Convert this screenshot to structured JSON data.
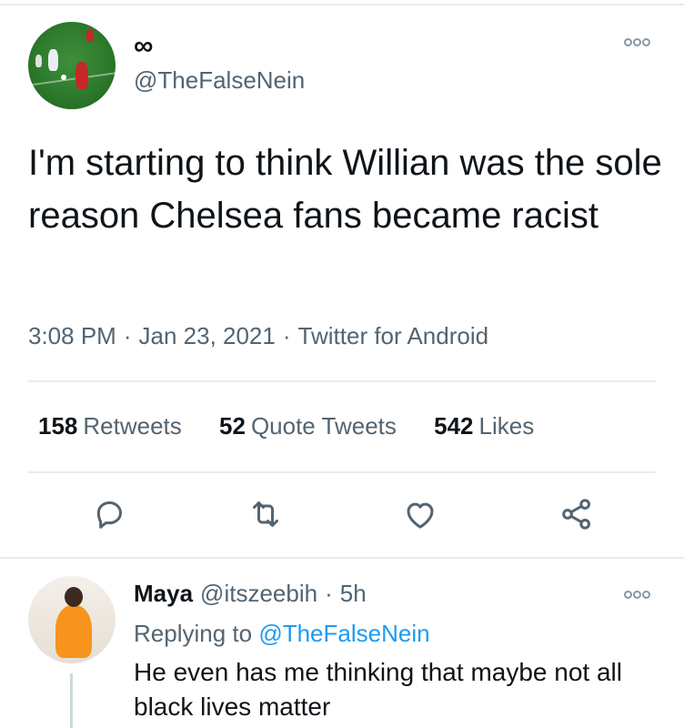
{
  "tweet": {
    "display_name": "∞",
    "handle": "@TheFalseNein",
    "text": "I'm starting to think Willian was the sole reason Chelsea fans became racist",
    "time": "3:08 PM",
    "date": "Jan 23, 2021",
    "client": "Twitter for Android",
    "separator": "·"
  },
  "stats": [
    {
      "count": "158",
      "label": "Retweets"
    },
    {
      "count": "52",
      "label": "Quote Tweets"
    },
    {
      "count": "542",
      "label": "Likes"
    }
  ],
  "actions": [
    "reply-icon",
    "retweet-icon",
    "like-icon",
    "share-icon"
  ],
  "reply": {
    "name": "Maya",
    "handle": "@itszeebih",
    "age": "5h",
    "separator": "·",
    "replying_prefix": "Replying to",
    "replying_to": "@TheFalseNein",
    "text": "He even has me thinking that maybe not all black lives matter"
  },
  "colors": {
    "text": "#0f1419",
    "secondary": "#536471",
    "accent": "#1d9bf0",
    "divider": "#e6ecf0"
  }
}
